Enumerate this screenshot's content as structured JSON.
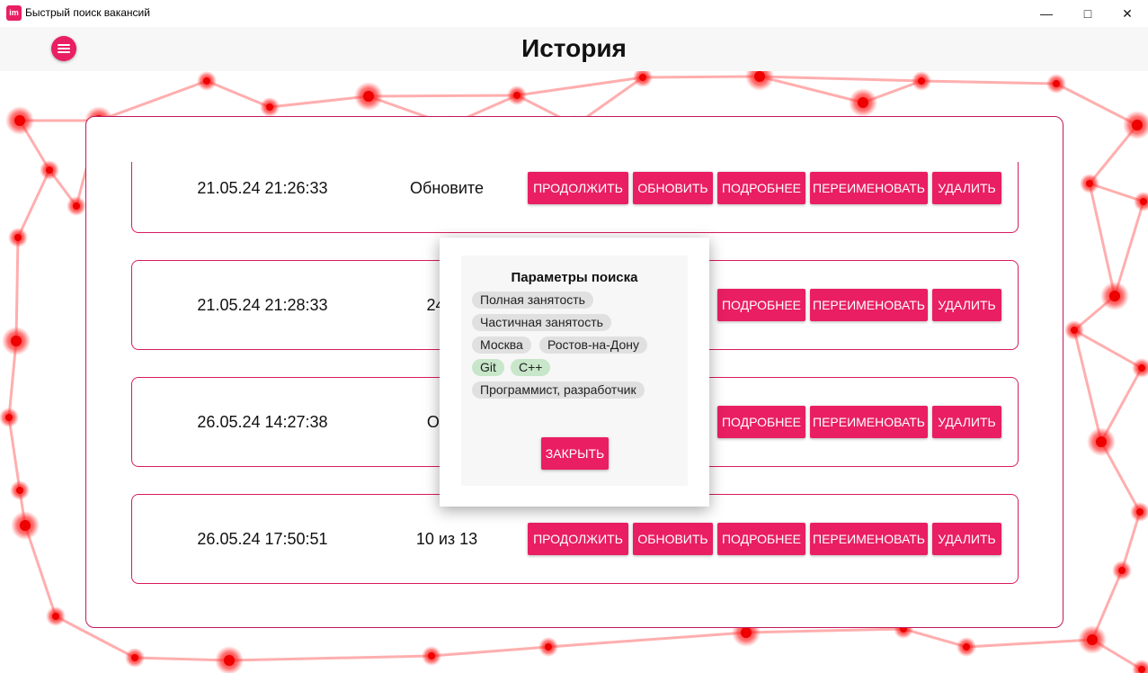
{
  "window": {
    "title": "Быстрый поиск вакансий",
    "icon_text": "im"
  },
  "header": {
    "title": "История"
  },
  "rows": [
    {
      "date": "21.05.24 21:26:33",
      "status": "Обновите",
      "buttons": {
        "continue": "ПРОДОЛЖИТЬ",
        "update": "ОБНОВИТЬ",
        "details": "ПОДРОБНЕЕ",
        "rename": "ПЕРЕИМЕНОВАТЬ",
        "delete": "УДАЛИТЬ"
      }
    },
    {
      "date": "21.05.24 21:28:33",
      "status": "243 и",
      "buttons": {
        "continue": "",
        "update": "",
        "details": "ПОДРОБНЕЕ",
        "rename": "ПЕРЕИМЕНОВАТЬ",
        "delete": "УДАЛИТЬ"
      }
    },
    {
      "date": "26.05.24 14:27:38",
      "status": "Обно",
      "buttons": {
        "continue": "",
        "update": "",
        "details": "ПОДРОБНЕЕ",
        "rename": "ПЕРЕИМЕНОВАТЬ",
        "delete": "УДАЛИТЬ"
      }
    },
    {
      "date": "26.05.24 17:50:51",
      "status": "10 из 13",
      "buttons": {
        "continue": "ПРОДОЛЖИТЬ",
        "update": "ОБНОВИТЬ",
        "details": "ПОДРОБНЕЕ",
        "rename": "ПЕРЕИМЕНОВАТЬ",
        "delete": "УДАЛИТЬ"
      }
    }
  ],
  "dialog": {
    "title": "Параметры поиска",
    "chips": [
      {
        "label": "Полная занятость",
        "tone": "gray"
      },
      {
        "label": "Частичная занятость",
        "tone": "gray"
      },
      {
        "label": "Москва",
        "tone": "gray"
      },
      {
        "label": "Ростов-на-Дону",
        "tone": "gray"
      },
      {
        "label": "Git",
        "tone": "green"
      },
      {
        "label": "C++",
        "tone": "green"
      },
      {
        "label": "Программист, разработчик",
        "tone": "gray"
      }
    ],
    "close_label": "ЗАКРЫТЬ"
  },
  "colors": {
    "accent": "#e91e63",
    "border": "#d81b60",
    "chip_gray": "#e0e0e0",
    "chip_green": "#c8e6c9"
  }
}
